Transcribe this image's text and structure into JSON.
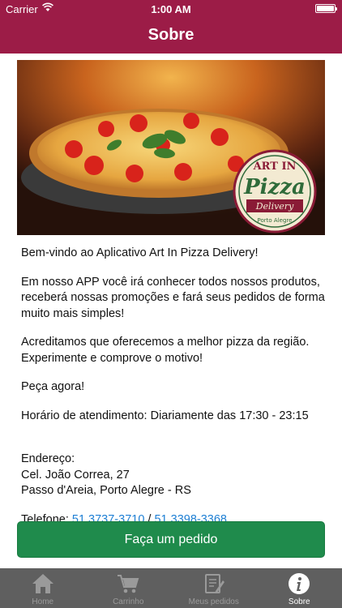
{
  "status_bar": {
    "carrier": "Carrier",
    "time": "1:00 AM"
  },
  "header": {
    "title": "Sobre"
  },
  "banner": {
    "logo_line1": "ART IN",
    "logo_line2": "Pizza",
    "logo_line3": "Delivery",
    "logo_line4": "Porto Alegre"
  },
  "content": {
    "welcome": "Bem-vindo ao Aplicativo Art In Pizza Delivery!",
    "intro": "Em nosso APP você irá conhecer todos nossos produtos, receberá nossas promoções e fará seus pedidos de forma muito mais simples!",
    "best": "Acreditamos que oferecemos a melhor pizza da região. Experimente e comprove o motivo!",
    "cta_text": "Peça agora!",
    "hours": "Horário de atendimento: Diariamente das 17:30 - 23:15",
    "address_label": "Endereço:",
    "address_line1": "Cel. João Correa, 27",
    "address_line2": "Passo d'Areia, Porto Alegre - RS",
    "phone_label": "Telefone: ",
    "phone1": "51 3737-3710",
    "phone_sep": " / ",
    "phone2": "51 3398-3368"
  },
  "order_button": {
    "label": "Faça um pedido"
  },
  "tabbar": {
    "tabs": [
      {
        "label": "Home",
        "icon": "home-icon"
      },
      {
        "label": "Carrinho",
        "icon": "cart-icon"
      },
      {
        "label": "Meus pedidos",
        "icon": "orders-icon"
      },
      {
        "label": "Sobre",
        "icon": "info-icon",
        "active": true
      }
    ]
  },
  "colors": {
    "header": "#9c1c47",
    "button": "#1f8b4c",
    "tabbar": "#5f5f5f",
    "link": "#1e7fd4"
  }
}
